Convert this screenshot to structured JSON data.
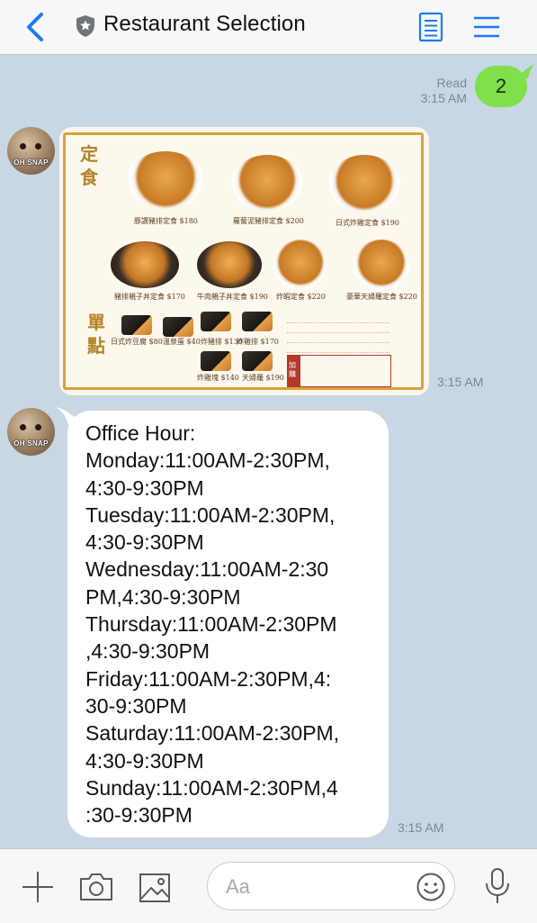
{
  "header": {
    "title": "Restaurant Selection"
  },
  "chat": {
    "read_label": "Read",
    "sent_message": "2",
    "sent_time": "3:15 AM",
    "image_time": "3:15 AM",
    "text_time": "3:15 AM",
    "avatar_caption": "OH SNAP",
    "menu_image": {
      "big_chars_1": "定食",
      "big_chars_2": "單點",
      "dishes": [
        "豚讚豬排定食 $180",
        "蘿蔔泥豬排定食 $200",
        "日式炸雞定食 $190",
        "豬排親子丼定食 $170",
        "牛肉親子丼定食 $190",
        "炸蝦定食 $220",
        "豪華天婦羅定食 $220"
      ],
      "side_dishes": [
        "日式炸豆腐 $80",
        "溫泉蛋 $40",
        "炸豬排 $130",
        "炸雞排 $170",
        "炸雞塊 $140",
        "天婦羅 $190"
      ],
      "add_on_label": "加購"
    },
    "office_hours_text": "Office Hour:\nMonday:11:00AM-2:30PM,\n4:30-9:30PM\nTuesday:11:00AM-2:30PM,\n4:30-9:30PM\nWednesday:11:00AM-2:30\nPM,4:30-9:30PM\nThursday:11:00AM-2:30PM\n,4:30-9:30PM\nFriday:11:00AM-2:30PM,4:\n30-9:30PM\nSaturday:11:00AM-2:30PM,\n4:30-9:30PM\nSunday:11:00AM-2:30PM,4\n:30-9:30PM"
  },
  "input": {
    "placeholder": "Aa"
  },
  "icons": {
    "back": "chevron-left-icon",
    "header_badge": "shield-icon",
    "notes": "notes-icon",
    "menu": "hamburger-menu-icon",
    "plus": "plus-icon",
    "camera": "camera-icon",
    "image": "image-icon",
    "emoji": "emoji-icon",
    "mic": "microphone-icon"
  },
  "colors": {
    "accent": "#1a7cf5",
    "sent_bubble": "#80e04a",
    "chat_background": "#c9d6e3",
    "timestamp": "#7b8794"
  }
}
